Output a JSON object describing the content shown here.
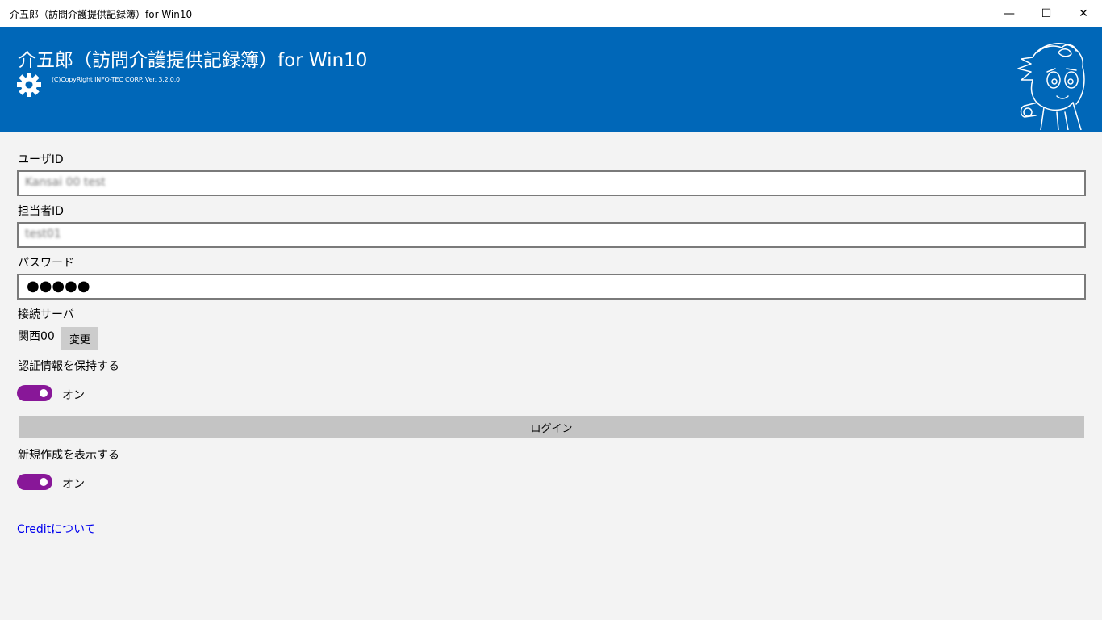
{
  "window": {
    "title": "介五郎（訪問介護提供記録簿）for Win10",
    "minimize_glyph": "—",
    "maximize_glyph": "☐",
    "close_glyph": "✕"
  },
  "header": {
    "app_title": "介五郎（訪問介護提供記録簿）for Win10",
    "copyright": "(C)CopyRight INFO-TEC CORP.  Ver.   3.2.0.0",
    "settings_icon": "gear-icon",
    "mascot_icon": "mascot-character",
    "bg_color": "#0067b8"
  },
  "form": {
    "user_id_label": "ユーザID",
    "user_id_value": "Kansai 00 test",
    "staff_id_label": "担当者ID",
    "staff_id_value": "test01",
    "password_label": "パスワード",
    "password_value": "●●●●●",
    "server_label": "接続サーバ",
    "server_value": "関西00",
    "change_button": "変更",
    "remember_label": "認証情報を保持する",
    "remember_toggle": "オン",
    "login_button": "ログイン",
    "show_new_label": "新規作成を表示する",
    "show_new_toggle": "オン",
    "credit_link": "Creditについて",
    "toggle_color": "#881798"
  }
}
